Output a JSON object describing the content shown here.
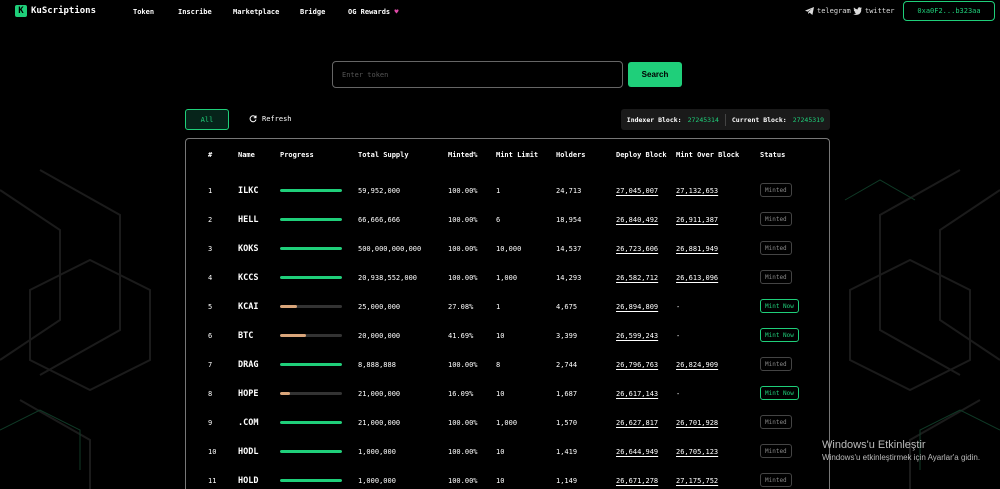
{
  "nav": {
    "logo_text": "KuScriptions",
    "links": [
      "Token",
      "Inscribe",
      "Marketplace",
      "Bridge",
      "OG Rewards"
    ],
    "telegram_label": "telegram",
    "twitter_label": "twitter",
    "wallet": "0xa0F2...b323aa"
  },
  "search": {
    "placeholder": "Enter token",
    "button": "Search"
  },
  "toolbar": {
    "all_tab": "All",
    "refresh": "Refresh",
    "indexer_label": "Indexer Block:",
    "indexer_value": "27245314",
    "current_label": "Current Block:",
    "current_value": "27245319"
  },
  "table": {
    "headers": [
      "#",
      "Name",
      "Progress",
      "Total Supply",
      "Minted%",
      "Mint Limit",
      "Holders",
      "Deploy Block",
      "Mint Over Block",
      "Status"
    ],
    "rows": [
      {
        "num": "1",
        "name": "ILKC",
        "progress": 1.0,
        "supply": "59,952,000",
        "minted": "100.00%",
        "limit": "1",
        "holders": "24,713",
        "deploy": "27,045,007",
        "over": "27,132,653",
        "status": "Minted"
      },
      {
        "num": "2",
        "name": "HELL",
        "progress": 1.0,
        "supply": "66,666,666",
        "minted": "100.00%",
        "limit": "6",
        "holders": "18,954",
        "deploy": "26,840,492",
        "over": "26,911,387",
        "status": "Minted"
      },
      {
        "num": "3",
        "name": "KOKS",
        "progress": 1.0,
        "supply": "500,000,000,000",
        "minted": "100.00%",
        "limit": "10,000",
        "holders": "14,537",
        "deploy": "26,723,606",
        "over": "26,881,949",
        "status": "Minted"
      },
      {
        "num": "4",
        "name": "KCCS",
        "progress": 1.0,
        "supply": "20,938,552,000",
        "minted": "100.00%",
        "limit": "1,000",
        "holders": "14,293",
        "deploy": "26,582,712",
        "over": "26,613,096",
        "status": "Minted"
      },
      {
        "num": "5",
        "name": "KCAI",
        "progress": 0.2708,
        "supply": "25,000,000",
        "minted": "27.08%",
        "limit": "1",
        "holders": "4,675",
        "deploy": "26,894,809",
        "over": "-",
        "status": "Mint Now"
      },
      {
        "num": "6",
        "name": "BTC",
        "progress": 0.4169,
        "supply": "20,000,000",
        "minted": "41.69%",
        "limit": "10",
        "holders": "3,399",
        "deploy": "26,599,243",
        "over": "-",
        "status": "Mint Now"
      },
      {
        "num": "7",
        "name": "DRAG",
        "progress": 1.0,
        "supply": "8,888,888",
        "minted": "100.00%",
        "limit": "8",
        "holders": "2,744",
        "deploy": "26,796,763",
        "over": "26,824,909",
        "status": "Minted"
      },
      {
        "num": "8",
        "name": "HOPE",
        "progress": 0.1609,
        "supply": "21,000,000",
        "minted": "16.09%",
        "limit": "10",
        "holders": "1,687",
        "deploy": "26,617,143",
        "over": "-",
        "status": "Mint Now"
      },
      {
        "num": "9",
        "name": ".COM",
        "progress": 1.0,
        "supply": "21,000,000",
        "minted": "100.00%",
        "limit": "1,000",
        "holders": "1,570",
        "deploy": "26,627,817",
        "over": "26,701,928",
        "status": "Minted"
      },
      {
        "num": "10",
        "name": "HODL",
        "progress": 1.0,
        "supply": "1,000,000",
        "minted": "100.00%",
        "limit": "10",
        "holders": "1,419",
        "deploy": "26,644,949",
        "over": "26,705,123",
        "status": "Minted"
      },
      {
        "num": "11",
        "name": "HOLD",
        "progress": 1.0,
        "supply": "1,000,000",
        "minted": "100.00%",
        "limit": "10",
        "holders": "1,149",
        "deploy": "26,671,278",
        "over": "27,175,752",
        "status": "Minted"
      }
    ]
  },
  "watermark": {
    "line1": "Windows'u Etkinleştir",
    "line2": "Windows'u etkinleştirmek için Ayarlar'a gidin."
  },
  "colors": {
    "accent": "#1fcf7a",
    "partial": "#d9a57a"
  }
}
